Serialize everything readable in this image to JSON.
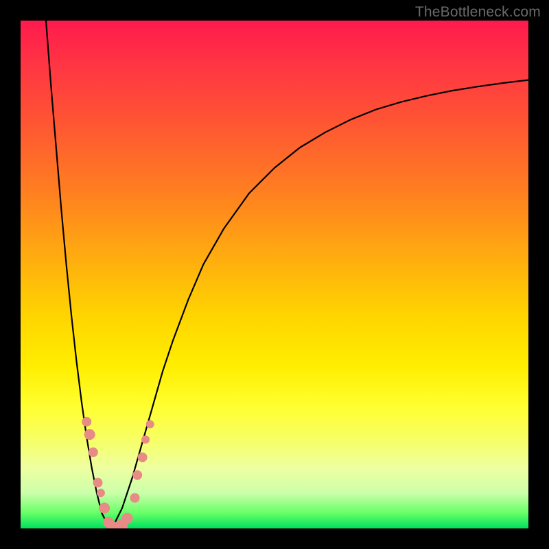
{
  "watermark": "TheBottleneck.com",
  "chart_data": {
    "type": "line",
    "title": "",
    "xlabel": "",
    "ylabel": "",
    "xlim": [
      0,
      100
    ],
    "ylim": [
      0,
      100
    ],
    "series": [
      {
        "name": "left-curve",
        "x": [
          5,
          6,
          7,
          8,
          9,
          10,
          11,
          12,
          13,
          14,
          15,
          16,
          17,
          18
        ],
        "values": [
          100,
          87,
          75,
          63,
          52,
          42,
          33,
          25,
          18,
          12,
          7,
          3,
          1,
          0
        ]
      },
      {
        "name": "right-curve",
        "x": [
          18,
          20,
          22,
          24,
          26,
          28,
          30,
          33,
          36,
          40,
          45,
          50,
          55,
          60,
          65,
          70,
          75,
          80,
          85,
          90,
          95,
          100
        ],
        "values": [
          0,
          4,
          10,
          17,
          24,
          31,
          37,
          45,
          52,
          59,
          66,
          71,
          75,
          78,
          80.5,
          82.5,
          84,
          85.2,
          86.2,
          87,
          87.7,
          88.3
        ]
      }
    ],
    "markers": {
      "name": "highlight-dots",
      "color": "#e88a85",
      "points": [
        {
          "x": 13.0,
          "y": 21.0,
          "r": 7
        },
        {
          "x": 13.6,
          "y": 18.5,
          "r": 8
        },
        {
          "x": 14.3,
          "y": 15.0,
          "r": 7
        },
        {
          "x": 15.2,
          "y": 9.0,
          "r": 7
        },
        {
          "x": 15.8,
          "y": 7.0,
          "r": 6
        },
        {
          "x": 16.5,
          "y": 4.0,
          "r": 8
        },
        {
          "x": 17.3,
          "y": 1.2,
          "r": 8
        },
        {
          "x": 18.2,
          "y": 0.3,
          "r": 8
        },
        {
          "x": 19.9,
          "y": 0.6,
          "r": 9
        },
        {
          "x": 21.0,
          "y": 2.0,
          "r": 8
        },
        {
          "x": 22.5,
          "y": 6.0,
          "r": 7
        },
        {
          "x": 23.0,
          "y": 10.5,
          "r": 7
        },
        {
          "x": 24.0,
          "y": 14.0,
          "r": 7
        },
        {
          "x": 24.6,
          "y": 17.5,
          "r": 6
        },
        {
          "x": 25.5,
          "y": 20.5,
          "r": 6
        }
      ]
    }
  }
}
